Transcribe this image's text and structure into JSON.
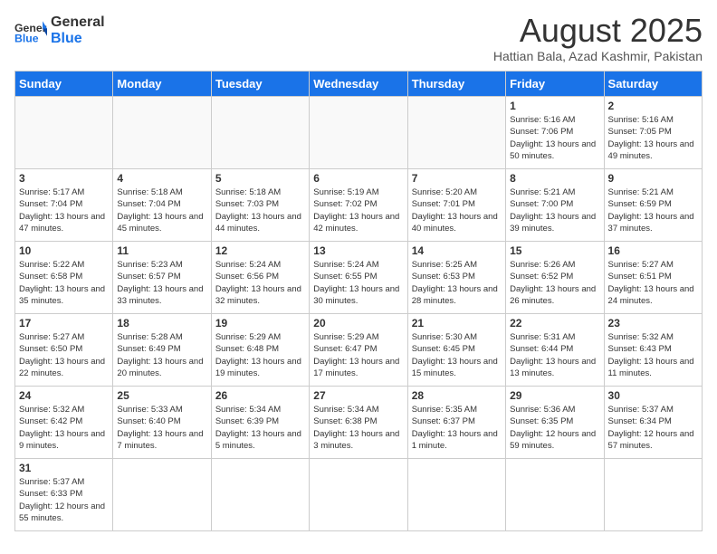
{
  "header": {
    "logo_general": "General",
    "logo_blue": "Blue",
    "month_title": "August 2025",
    "subtitle": "Hattian Bala, Azad Kashmir, Pakistan"
  },
  "weekdays": [
    "Sunday",
    "Monday",
    "Tuesday",
    "Wednesday",
    "Thursday",
    "Friday",
    "Saturday"
  ],
  "days": [
    {
      "num": "",
      "info": ""
    },
    {
      "num": "",
      "info": ""
    },
    {
      "num": "",
      "info": ""
    },
    {
      "num": "",
      "info": ""
    },
    {
      "num": "",
      "info": ""
    },
    {
      "num": "1",
      "info": "Sunrise: 5:16 AM\nSunset: 7:06 PM\nDaylight: 13 hours and 50 minutes."
    },
    {
      "num": "2",
      "info": "Sunrise: 5:16 AM\nSunset: 7:05 PM\nDaylight: 13 hours and 49 minutes."
    },
    {
      "num": "3",
      "info": "Sunrise: 5:17 AM\nSunset: 7:04 PM\nDaylight: 13 hours and 47 minutes."
    },
    {
      "num": "4",
      "info": "Sunrise: 5:18 AM\nSunset: 7:04 PM\nDaylight: 13 hours and 45 minutes."
    },
    {
      "num": "5",
      "info": "Sunrise: 5:18 AM\nSunset: 7:03 PM\nDaylight: 13 hours and 44 minutes."
    },
    {
      "num": "6",
      "info": "Sunrise: 5:19 AM\nSunset: 7:02 PM\nDaylight: 13 hours and 42 minutes."
    },
    {
      "num": "7",
      "info": "Sunrise: 5:20 AM\nSunset: 7:01 PM\nDaylight: 13 hours and 40 minutes."
    },
    {
      "num": "8",
      "info": "Sunrise: 5:21 AM\nSunset: 7:00 PM\nDaylight: 13 hours and 39 minutes."
    },
    {
      "num": "9",
      "info": "Sunrise: 5:21 AM\nSunset: 6:59 PM\nDaylight: 13 hours and 37 minutes."
    },
    {
      "num": "10",
      "info": "Sunrise: 5:22 AM\nSunset: 6:58 PM\nDaylight: 13 hours and 35 minutes."
    },
    {
      "num": "11",
      "info": "Sunrise: 5:23 AM\nSunset: 6:57 PM\nDaylight: 13 hours and 33 minutes."
    },
    {
      "num": "12",
      "info": "Sunrise: 5:24 AM\nSunset: 6:56 PM\nDaylight: 13 hours and 32 minutes."
    },
    {
      "num": "13",
      "info": "Sunrise: 5:24 AM\nSunset: 6:55 PM\nDaylight: 13 hours and 30 minutes."
    },
    {
      "num": "14",
      "info": "Sunrise: 5:25 AM\nSunset: 6:53 PM\nDaylight: 13 hours and 28 minutes."
    },
    {
      "num": "15",
      "info": "Sunrise: 5:26 AM\nSunset: 6:52 PM\nDaylight: 13 hours and 26 minutes."
    },
    {
      "num": "16",
      "info": "Sunrise: 5:27 AM\nSunset: 6:51 PM\nDaylight: 13 hours and 24 minutes."
    },
    {
      "num": "17",
      "info": "Sunrise: 5:27 AM\nSunset: 6:50 PM\nDaylight: 13 hours and 22 minutes."
    },
    {
      "num": "18",
      "info": "Sunrise: 5:28 AM\nSunset: 6:49 PM\nDaylight: 13 hours and 20 minutes."
    },
    {
      "num": "19",
      "info": "Sunrise: 5:29 AM\nSunset: 6:48 PM\nDaylight: 13 hours and 19 minutes."
    },
    {
      "num": "20",
      "info": "Sunrise: 5:29 AM\nSunset: 6:47 PM\nDaylight: 13 hours and 17 minutes."
    },
    {
      "num": "21",
      "info": "Sunrise: 5:30 AM\nSunset: 6:45 PM\nDaylight: 13 hours and 15 minutes."
    },
    {
      "num": "22",
      "info": "Sunrise: 5:31 AM\nSunset: 6:44 PM\nDaylight: 13 hours and 13 minutes."
    },
    {
      "num": "23",
      "info": "Sunrise: 5:32 AM\nSunset: 6:43 PM\nDaylight: 13 hours and 11 minutes."
    },
    {
      "num": "24",
      "info": "Sunrise: 5:32 AM\nSunset: 6:42 PM\nDaylight: 13 hours and 9 minutes."
    },
    {
      "num": "25",
      "info": "Sunrise: 5:33 AM\nSunset: 6:40 PM\nDaylight: 13 hours and 7 minutes."
    },
    {
      "num": "26",
      "info": "Sunrise: 5:34 AM\nSunset: 6:39 PM\nDaylight: 13 hours and 5 minutes."
    },
    {
      "num": "27",
      "info": "Sunrise: 5:34 AM\nSunset: 6:38 PM\nDaylight: 13 hours and 3 minutes."
    },
    {
      "num": "28",
      "info": "Sunrise: 5:35 AM\nSunset: 6:37 PM\nDaylight: 13 hours and 1 minute."
    },
    {
      "num": "29",
      "info": "Sunrise: 5:36 AM\nSunset: 6:35 PM\nDaylight: 12 hours and 59 minutes."
    },
    {
      "num": "30",
      "info": "Sunrise: 5:37 AM\nSunset: 6:34 PM\nDaylight: 12 hours and 57 minutes."
    },
    {
      "num": "31",
      "info": "Sunrise: 5:37 AM\nSunset: 6:33 PM\nDaylight: 12 hours and 55 minutes."
    }
  ]
}
